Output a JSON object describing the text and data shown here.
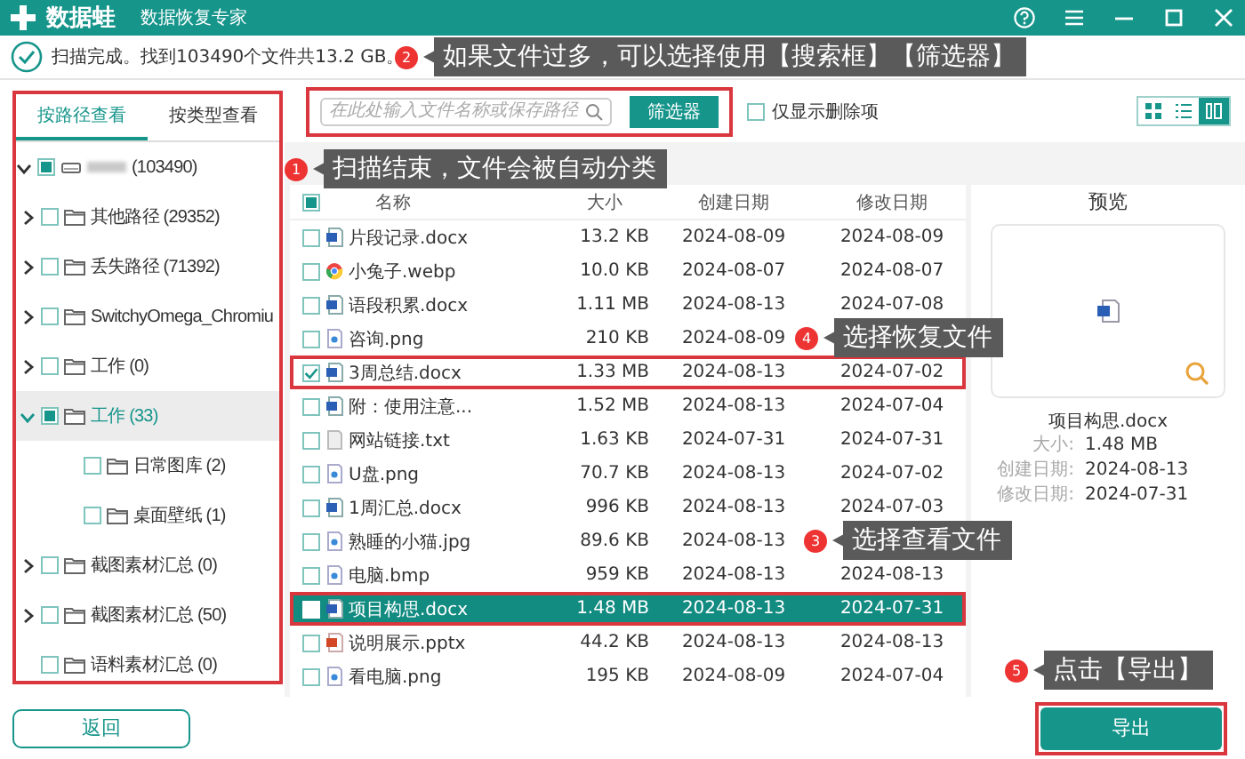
{
  "window": {
    "app_name": "数据蛙",
    "subtitle": "数据恢复专家"
  },
  "scan_status": "扫描完成。找到103490个文件共13.2 GB。",
  "view_tabs": [
    {
      "label": "按路径查看",
      "selected": true
    },
    {
      "label": "按类型查看",
      "selected": false
    }
  ],
  "tree": [
    {
      "kind": "drive",
      "label": "(103490)",
      "checked": false,
      "partial": true,
      "expanded": true,
      "selected": false,
      "children": [
        {
          "kind": "folder",
          "label": "其他路径 (29352)",
          "checked": false,
          "partial": false,
          "expanded": false,
          "selected": false
        },
        {
          "kind": "folder",
          "label": "丢失路径 (71392)",
          "checked": false,
          "partial": false,
          "expanded": false,
          "selected": false
        },
        {
          "kind": "folder",
          "label": "SwitchyOmega_Chromiu",
          "checked": false,
          "partial": false,
          "expanded": false,
          "selected": false
        },
        {
          "kind": "folder",
          "label": "工作 (0)",
          "checked": false,
          "partial": false,
          "expanded": false,
          "selected": false
        },
        {
          "kind": "folder",
          "label": "工作 (33)",
          "checked": false,
          "partial": true,
          "expanded": true,
          "selected": true,
          "children": [
            {
              "kind": "folder",
              "label": "日常图库 (2)",
              "checked": false,
              "partial": false,
              "selected": false
            },
            {
              "kind": "folder",
              "label": "桌面壁纸 (1)",
              "checked": false,
              "partial": false,
              "selected": false
            }
          ]
        },
        {
          "kind": "folder",
          "label": "截图素材汇总 (0)",
          "checked": false,
          "partial": false,
          "expanded": false,
          "selected": false
        },
        {
          "kind": "folder",
          "label": "截图素材汇总 (50)",
          "checked": false,
          "partial": false,
          "expanded": false,
          "selected": false
        },
        {
          "kind": "folder",
          "label": "语料素材汇总 (0)",
          "checked": false,
          "partial": false,
          "selected": false
        }
      ]
    }
  ],
  "search": {
    "placeholder": "在此处输入文件名称或保存路径"
  },
  "filter_button": "筛选器",
  "deleted_only": {
    "label": "仅显示删除项",
    "checked": false
  },
  "view_modes": [
    {
      "kind": "grid",
      "selected": false
    },
    {
      "kind": "list",
      "selected": false
    },
    {
      "kind": "detail",
      "selected": true
    }
  ],
  "table": {
    "columns": [
      "名称",
      "大小",
      "创建日期",
      "修改日期"
    ],
    "header_partial": true,
    "rows": [
      {
        "kind": "doc",
        "name": "片段记录.docx",
        "size": "13.2 KB",
        "created": "2024-08-09",
        "modified": "2024-08-09",
        "checked": false,
        "selected": false,
        "highlighted": false
      },
      {
        "kind": "browser",
        "name": "小兔子.webp",
        "size": "10.0 KB",
        "created": "2024-08-07",
        "modified": "2024-08-07",
        "checked": false,
        "selected": false,
        "highlighted": false
      },
      {
        "kind": "doc",
        "name": "语段积累.docx",
        "size": "1.11 MB",
        "created": "2024-08-13",
        "modified": "2024-07-08",
        "checked": false,
        "selected": false,
        "highlighted": false
      },
      {
        "kind": "image",
        "name": "咨询.png",
        "size": "210 KB",
        "created": "2024-08-09",
        "checked": false,
        "selected": false,
        "highlighted": false
      },
      {
        "kind": "doc",
        "name": "3周总结.docx",
        "size": "1.33 MB",
        "created": "2024-08-13",
        "modified": "2024-07-02",
        "checked": true,
        "selected": false,
        "highlighted": true
      },
      {
        "kind": "doc",
        "name": "附：使用注意...",
        "size": "1.52 MB",
        "created": "2024-08-13",
        "modified": "2024-07-04",
        "checked": false,
        "selected": false,
        "highlighted": false
      },
      {
        "kind": "text",
        "name": "网站链接.txt",
        "size": "1.63 KB",
        "created": "2024-07-31",
        "modified": "2024-07-31",
        "checked": false,
        "selected": false,
        "highlighted": false
      },
      {
        "kind": "image",
        "name": "U盘.png",
        "size": "70.7 KB",
        "created": "2024-08-13",
        "modified": "2024-07-02",
        "checked": false,
        "selected": false,
        "highlighted": false
      },
      {
        "kind": "doc",
        "name": "1周汇总.docx",
        "size": "996 KB",
        "created": "2024-08-13",
        "modified": "2024-07-03",
        "checked": false,
        "selected": false,
        "highlighted": false
      },
      {
        "kind": "image",
        "name": "熟睡的小猫.jpg",
        "size": "89.6 KB",
        "created": "2024-08-13",
        "checked": false,
        "selected": false,
        "highlighted": false
      },
      {
        "kind": "image",
        "name": "电脑.bmp",
        "size": "959 KB",
        "created": "2024-08-13",
        "modified": "2024-08-13",
        "checked": false,
        "selected": false,
        "highlighted": false
      },
      {
        "kind": "doc",
        "name": "项目构思.docx",
        "size": "1.48 MB",
        "created": "2024-08-13",
        "modified": "2024-07-31",
        "checked": false,
        "selected": true,
        "highlighted": true
      },
      {
        "kind": "slides",
        "name": "说明展示.pptx",
        "size": "44.2 KB",
        "created": "2024-08-13",
        "modified": "2024-08-13",
        "checked": false,
        "selected": false,
        "highlighted": false
      },
      {
        "kind": "image",
        "name": "看电脑.png",
        "size": "195 KB",
        "created": "2024-08-09",
        "modified": "2024-07-04",
        "checked": false,
        "selected": false,
        "highlighted": false
      }
    ]
  },
  "preview": {
    "title": "预览",
    "file_name": "项目构思.docx",
    "details": [
      {
        "label": "大小:",
        "value": "1.48 MB"
      },
      {
        "label": "创建日期:",
        "value": "2024-08-13"
      },
      {
        "label": "修改日期:",
        "value": "2024-07-31"
      }
    ]
  },
  "back_button": "返回",
  "export_button": "导出",
  "annotations": [
    {
      "number": "2",
      "text": "如果文件过多，可以选择使用【搜索框】【筛选器】"
    },
    {
      "number": "1",
      "text": "扫描结束，文件会被自动分类"
    },
    {
      "number": "4",
      "text": "选择恢复文件"
    },
    {
      "number": "3",
      "text": "选择查看文件"
    },
    {
      "number": "5",
      "text": "点击【导出】"
    }
  ]
}
